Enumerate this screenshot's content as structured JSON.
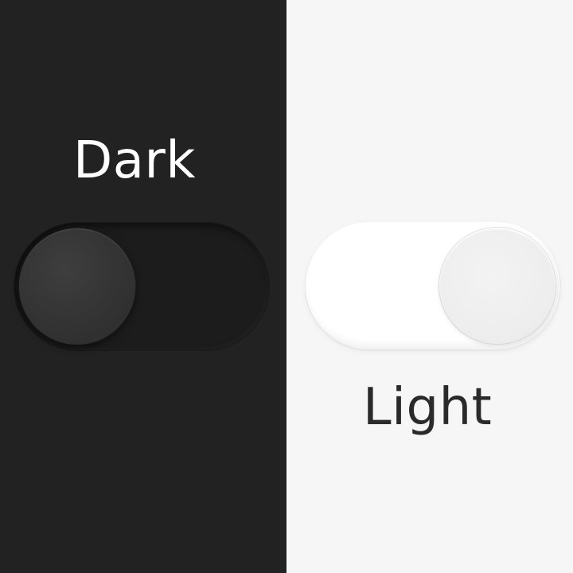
{
  "dark_panel": {
    "label": "Dark",
    "background_color": "#222222",
    "toggle": {
      "state": "off"
    }
  },
  "light_panel": {
    "label": "Light",
    "background_color": "#f6f6f6",
    "toggle": {
      "state": "on"
    }
  }
}
